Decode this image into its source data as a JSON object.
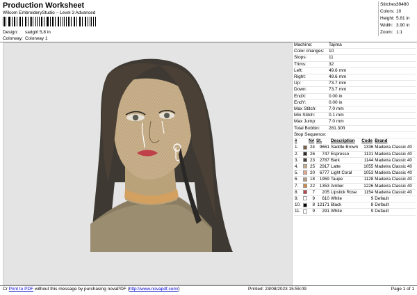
{
  "header": {
    "title": "Production Worksheet",
    "subtitle": "Wilcom EmbroideryStudio – Level 3 Advanced",
    "design_label": "Design:",
    "design_value": "sadgirl 5,8 in",
    "colorway_label": "Colorway:",
    "colorway_value": "Colorway 1"
  },
  "summary": [
    {
      "k": "Stitches:",
      "v": "39480"
    },
    {
      "k": "Colors:",
      "v": "10"
    },
    {
      "k": "Height:",
      "v": "5.81 in"
    },
    {
      "k": "Width:",
      "v": "3.90 in"
    },
    {
      "k": "Zoom:",
      "v": "1:1"
    }
  ],
  "machine_info": [
    {
      "k": "Machine:",
      "v": "Tajima"
    },
    {
      "k": "Color changes:",
      "v": "10"
    },
    {
      "k": "Stops:",
      "v": "11"
    },
    {
      "k": "Trims:",
      "v": "32"
    },
    {
      "k": "Left:",
      "v": "49.6 mm"
    },
    {
      "k": "Right:",
      "v": "49.6 mm"
    },
    {
      "k": "Up:",
      "v": "73.7 mm"
    },
    {
      "k": "Down:",
      "v": "73.7 mm"
    },
    {
      "k": "EndX:",
      "v": "0.00 in"
    },
    {
      "k": "EndY:",
      "v": "0.00 in"
    },
    {
      "k": "Max Stitch:",
      "v": "7.0 mm"
    },
    {
      "k": "Min Stitch:",
      "v": "0.1 mm"
    },
    {
      "k": "Max Jump:",
      "v": "7.0 mm"
    },
    {
      "k": "Total Bobbin:",
      "v": "281.30ft"
    }
  ],
  "stop_sequence": {
    "label": "Stop Sequence:",
    "columns": [
      "#",
      "N#",
      "St.",
      "Description",
      "Code",
      "Brand"
    ],
    "rows": [
      {
        "n": "1.",
        "nn": "24",
        "color": "#7a6248",
        "st": "9661",
        "desc": "Saddle Brown",
        "code": "1336",
        "brand": "Madeira Classic 40"
      },
      {
        "n": "2.",
        "nn": "26",
        "color": "#2a2826",
        "st": "747",
        "desc": "Espresso",
        "code": "1131",
        "brand": "Madeira Classic 40"
      },
      {
        "n": "3.",
        "nn": "23",
        "color": "#4a4035",
        "st": "2787",
        "desc": "Bark",
        "code": "1144",
        "brand": "Madeira Classic 40"
      },
      {
        "n": "4.",
        "nn": "25",
        "color": "#c9b08a",
        "st": "2917",
        "desc": "Latte",
        "code": "1055",
        "brand": "Madeira Classic 40"
      },
      {
        "n": "5.",
        "nn": "20",
        "color": "#e3a58c",
        "st": "6777",
        "desc": "Light Coral",
        "code": "1053",
        "brand": "Madeira Classic 40"
      },
      {
        "n": "6.",
        "nn": "18",
        "color": "#b39a80",
        "st": "1959",
        "desc": "Taupe",
        "code": "1128",
        "brand": "Madeira Classic 40"
      },
      {
        "n": "7.",
        "nn": "22",
        "color": "#d48a44",
        "st": "1353",
        "desc": "Amber",
        "code": "1226",
        "brand": "Madeira Classic 40"
      },
      {
        "n": "8.",
        "nn": "7",
        "color": "#c0404a",
        "st": "205",
        "desc": "Lipstick Rose",
        "code": "1154",
        "brand": "Madeira Classic 40"
      },
      {
        "n": "9.",
        "nn": "9",
        "color": "#ffffff",
        "st": "610",
        "desc": "White",
        "code": "9",
        "brand": "Default"
      },
      {
        "n": "10.",
        "nn": "8",
        "color": "#000000",
        "st": "12171",
        "desc": "Black",
        "code": "8",
        "brand": "Default"
      },
      {
        "n": "11.",
        "nn": "9",
        "color": "#ffffff",
        "st": "291",
        "desc": "White",
        "code": "9",
        "brand": "Default"
      }
    ]
  },
  "footer": {
    "prefix": "Cr",
    "link_text": "Print to PDF",
    "middle_text": " without this message by purchasing novaPDF (",
    "url_text": "http://www.novapdf.com/",
    "suffix_text": ")",
    "printed": "Printed: 23/08/2023 15:55:09",
    "page": "Page 1 of 1"
  }
}
